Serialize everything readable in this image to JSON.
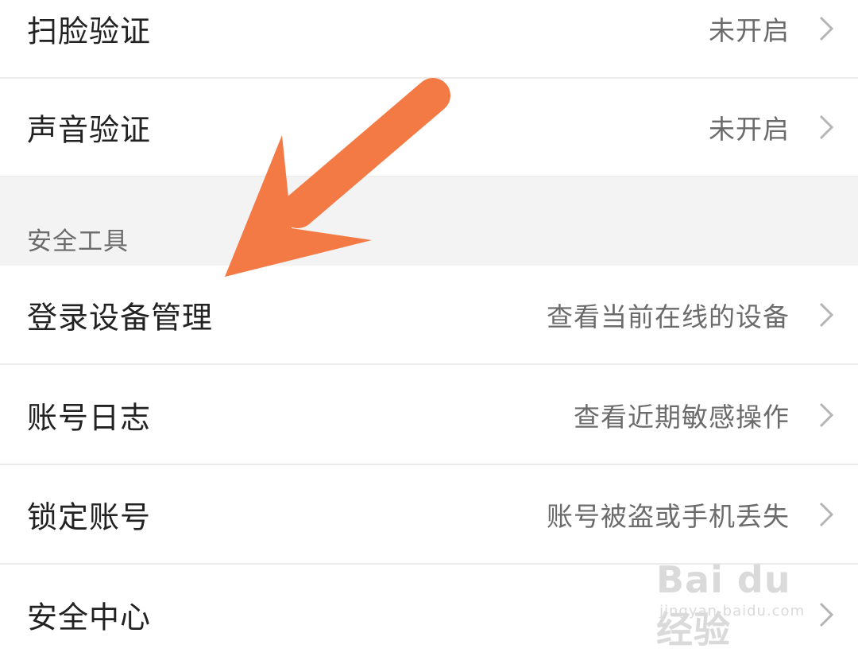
{
  "rows_top": [
    {
      "label": "扫脸验证",
      "value": "未开启"
    },
    {
      "label": "声音验证",
      "value": "未开启"
    }
  ],
  "section": {
    "title": "安全工具"
  },
  "rows_tools": [
    {
      "label": "登录设备管理",
      "value": "查看当前在线的设备"
    },
    {
      "label": "账号日志",
      "value": "查看近期敏感操作"
    },
    {
      "label": "锁定账号",
      "value": "账号被盗或手机丢失"
    },
    {
      "label": "安全中心",
      "value": ""
    }
  ],
  "watermark": {
    "logo": "Bai du 经验",
    "sub": "jingyan.baidu.com"
  },
  "colors": {
    "arrow": "#f47a45",
    "section_bg": "#f3f3f3",
    "chevron": "#b5b5b5"
  },
  "icons": {
    "chevron": "chevron-right-icon",
    "annotation": "arrow-icon"
  }
}
